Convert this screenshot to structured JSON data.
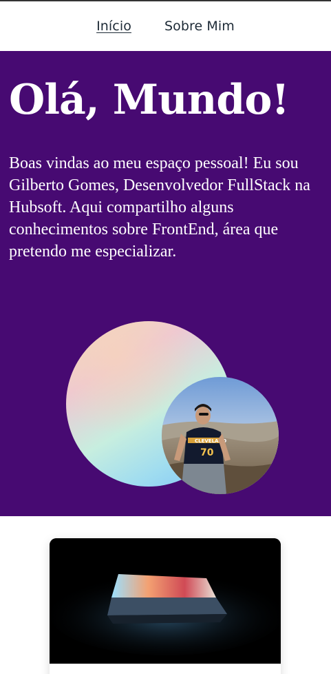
{
  "nav": {
    "items": [
      {
        "label": "Início",
        "active": true
      },
      {
        "label": "Sobre Mim",
        "active": false
      }
    ]
  },
  "hero": {
    "title": "Olá, Mundo!",
    "text": "Boas vindas ao meu espaço pessoal! Eu sou Gilberto Gomes, Desenvolvedor FullStack na Hubsoft. Aqui compartilho alguns conhecimentos sobre FrontEnd, área que pretendo me especializar.",
    "background_color": "#470a72",
    "photo_shirt_text": "CLEVELAND",
    "photo_shirt_number": "70"
  },
  "card": {
    "image_subject": "laptop"
  }
}
